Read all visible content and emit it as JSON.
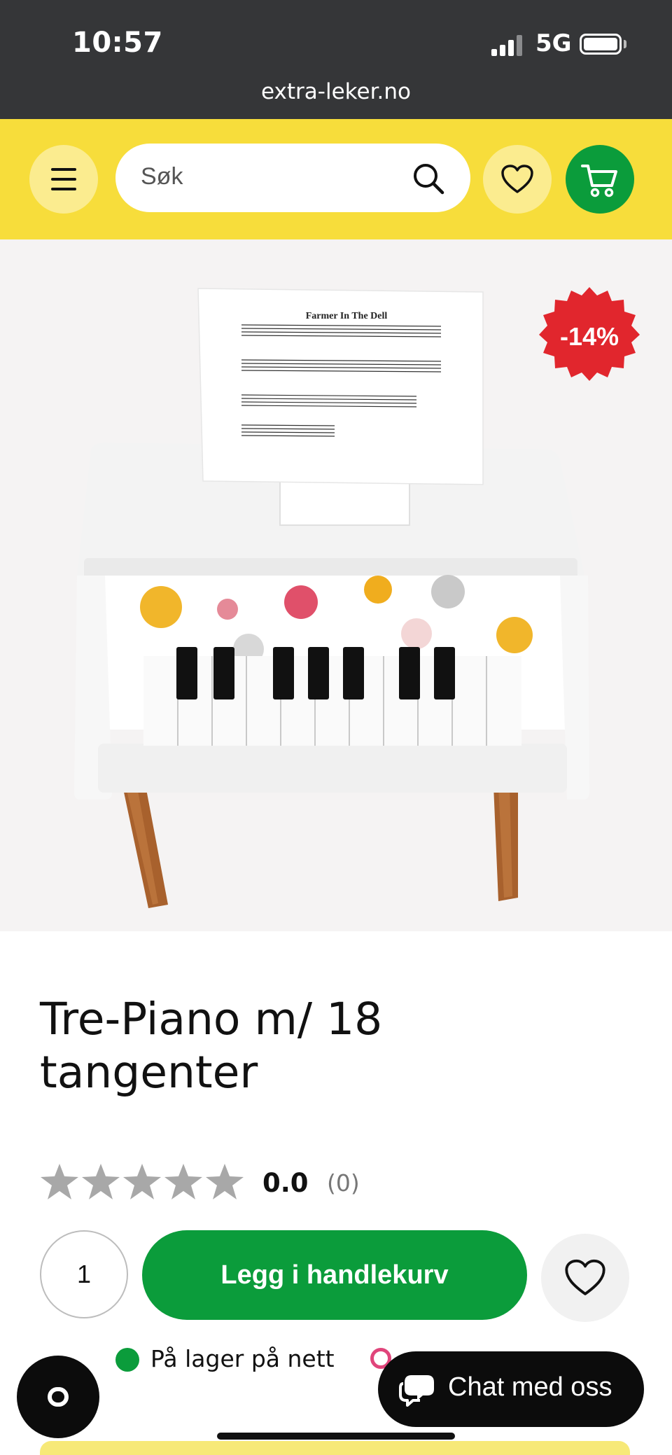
{
  "status_bar": {
    "time": "10:57",
    "network": "5G",
    "url": "extra-leker.no"
  },
  "header": {
    "search_placeholder": "Søk",
    "icons": [
      "menu-icon",
      "search-icon",
      "heart-icon",
      "cart-icon"
    ],
    "colors": {
      "header_bg": "#f7dd3b",
      "accent_green": "#0b9c3b"
    }
  },
  "product": {
    "discount_badge": "-14%",
    "image_sheet_title": "Farmer In The Dell",
    "title": "Tre-Piano m/ 18 tangenter",
    "rating": {
      "value": "0.0",
      "count": "(0)",
      "stars_filled": 0,
      "stars_total": 5
    },
    "quantity": "1",
    "add_to_cart_label": "Legg i handlekurv",
    "stock_online": "På lager på nett"
  },
  "widgets": {
    "chat_label": "Chat med oss"
  }
}
